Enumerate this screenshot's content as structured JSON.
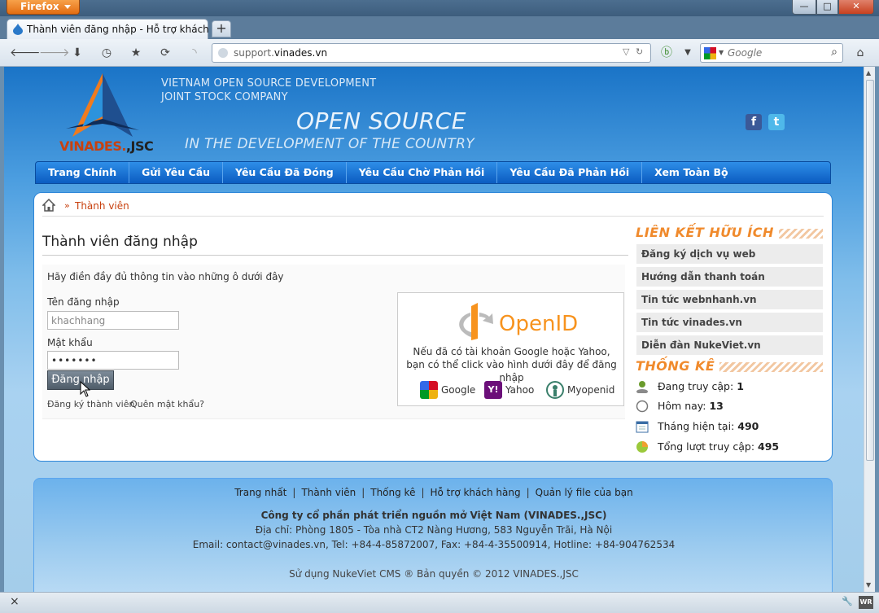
{
  "browser": {
    "app_button": "Firefox",
    "tab_title": "Thành viên đăng nhập - Hỗ trợ khách h...",
    "new_tab_label": "+",
    "url_host_prefix": "support.",
    "url_host_main": "vinades.vn",
    "search_placeholder": "Google"
  },
  "header": {
    "logo_text_main": "VINADES.",
    "logo_text_suffix": ",JSC",
    "company_line1": "VIETNAM OPEN SOURCE DEVELOPMENT",
    "company_line2": "JOINT STOCK COMPANY",
    "slogan_line1": "OPEN SOURCE",
    "slogan_line2": "IN THE DEVELOPMENT OF THE COUNTRY",
    "facebook_label": "f",
    "twitter_label": "t"
  },
  "menu": [
    {
      "label": "Trang Chính"
    },
    {
      "label": "Gửi Yêu Cầu"
    },
    {
      "label": "Yêu Cầu Đã Đóng"
    },
    {
      "label": "Yêu Cầu Chờ Phản Hồi"
    },
    {
      "label": "Yêu Cầu Đã Phản Hồi"
    },
    {
      "label": "Xem Toàn Bộ"
    }
  ],
  "breadcrumb": {
    "separator": "»",
    "current": "Thành viên"
  },
  "login": {
    "title": "Thành viên đăng nhập",
    "intro": "Hãy điền đầy đủ thông tin vào những ô dưới đây",
    "username_label": "Tên đăng nhập",
    "username_value": "khachhang",
    "password_label": "Mật khẩu",
    "password_value": "•••••••",
    "submit_label": "Đăng nhập",
    "register_link": "Đăng ký thành viên",
    "forgot_link": "Quên mật khẩu?"
  },
  "openid": {
    "logo_text": "OpenID",
    "text_line1": "Nếu đã có tài khoản Google hoặc Yahoo,",
    "text_line2": "bạn có thể click vào hình dưới đây để đăng nhập",
    "providers": [
      {
        "label": "Google"
      },
      {
        "label": "Yahoo"
      },
      {
        "label": "Myopenid"
      }
    ]
  },
  "sidebar": {
    "links_title": "LIÊN KẾT HỮU ÍCH",
    "links": [
      {
        "label": "Đăng ký dịch vụ web"
      },
      {
        "label": "Hướng dẫn thanh toán"
      },
      {
        "label": "Tin tức webnhanh.vn"
      },
      {
        "label": "Tin tức vinades.vn"
      },
      {
        "label": "Diễn đàn NukeViet.vn"
      }
    ],
    "stats_title": "THỐNG KÊ",
    "stats": [
      {
        "label": "Đang truy cập:",
        "value": "1"
      },
      {
        "label": "Hôm nay:",
        "value": "13"
      },
      {
        "label": "Tháng hiện tại:",
        "value": "490"
      },
      {
        "label": "Tổng lượt truy cập:",
        "value": "495"
      }
    ]
  },
  "footer": {
    "links": [
      {
        "label": "Trang nhất"
      },
      {
        "label": "Thành viên"
      },
      {
        "label": "Thống kê"
      },
      {
        "label": "Hỗ trợ khách hàng"
      },
      {
        "label": "Quản lý file của bạn"
      }
    ],
    "link_separator": "|",
    "company": "Công ty cổ phần phát triển nguồn mở Việt Nam (VINADES.,JSC)",
    "address": "Địa chỉ: Phòng 1805 - Tòa nhà CT2 Nàng Hương, 583 Nguyễn Trãi, Hà Nội",
    "contact": "Email: contact@vinades.vn, Tel: +84-4-85872007, Fax: +84-4-35500914, Hotline: +84-904762534",
    "copyright": "Sử dụng NukeViet CMS ® Bản quyền © 2012 VINADES.,JSC"
  },
  "statusbar": {
    "close_label": "×",
    "addon_label": "WR"
  },
  "colors": {
    "menu_blue": "#0b5cc1",
    "accent_orange": "#f08a2c",
    "breadcrumb_red": "#c8410f"
  }
}
